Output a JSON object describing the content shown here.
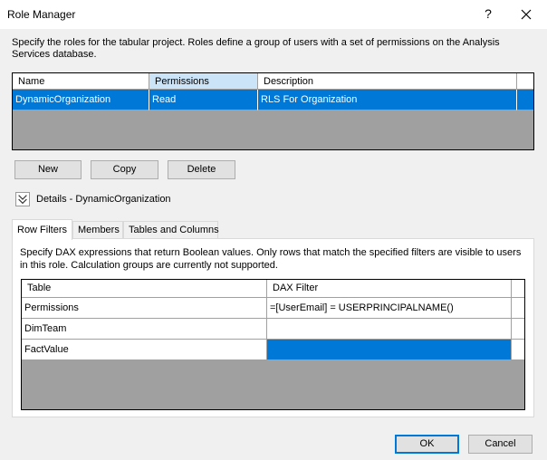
{
  "window": {
    "title": "Role Manager",
    "help_glyph": "?"
  },
  "description": "Specify the roles for the tabular project. Roles define a group of users with a set of permissions on the Analysis Services database.",
  "roles_table": {
    "headers": [
      "Name",
      "Permissions",
      "Description"
    ],
    "rows": [
      {
        "name": "DynamicOrganization",
        "permissions": "Read",
        "description": "RLS For Organization"
      }
    ]
  },
  "buttons": {
    "new": "New",
    "copy": "Copy",
    "delete": "Delete",
    "ok": "OK",
    "cancel": "Cancel"
  },
  "details": {
    "label": "Details - DynamicOrganization",
    "icon": "chevron-double-down-icon"
  },
  "tabs": [
    "Row Filters",
    "Members",
    "Tables and Columns"
  ],
  "row_filters": {
    "description": "Specify DAX expressions that return Boolean values. Only rows that match the specified filters are visible to users in this role. Calculation groups are currently not supported.",
    "headers": [
      "Table",
      "DAX Filter"
    ],
    "rows": [
      {
        "table": "Permissions",
        "filter": "=[UserEmail]  = USERPRINCIPALNAME()"
      },
      {
        "table": "DimTeam",
        "filter": ""
      },
      {
        "table": "FactValue",
        "filter": ""
      }
    ]
  },
  "colors": {
    "selection": "#0078d7",
    "header_selected": "#cce4f7",
    "grid_empty": "#a0a0a0"
  }
}
